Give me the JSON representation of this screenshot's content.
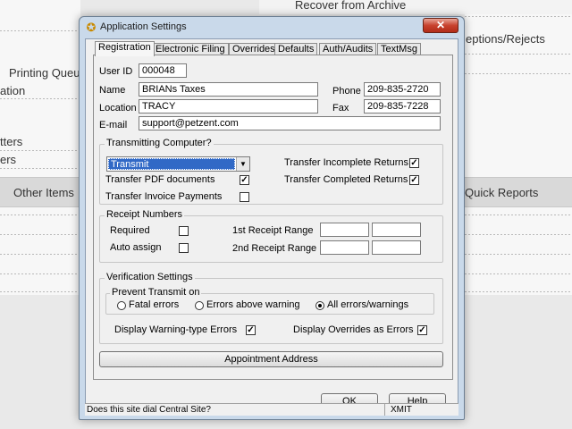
{
  "background": {
    "items": [
      "Recover from Archive",
      "Printing Queue",
      "ation",
      "tters",
      "ers",
      "Other Items",
      "eptions/Rejects",
      "Quick Reports"
    ]
  },
  "dialog": {
    "title": "Application Settings",
    "close_label": "✕",
    "tabs": [
      "Registration",
      "Electronic Filing",
      "Overrides",
      "Defaults",
      "Auth/Audits",
      "TextMsg"
    ],
    "active_tab": "Registration",
    "registration": {
      "user_id_label": "User ID",
      "user_id": "000048",
      "name_label": "Name",
      "name": "BRIANs Taxes",
      "phone_label": "Phone",
      "phone": "209-835-2720",
      "location_label": "Location",
      "location": "TRACY",
      "fax_label": "Fax",
      "fax": "209-835-7228",
      "email_label": "E-mail",
      "email": "support@petzent.com"
    },
    "transmitting": {
      "title": "Transmitting Computer?",
      "combo_value": "Transmit",
      "transfer_pdf": "Transfer PDF documents",
      "transfer_pdf_checked": true,
      "transfer_invoice": "Transfer Invoice Payments",
      "transfer_invoice_checked": false,
      "transfer_incomplete": "Transfer Incomplete Returns",
      "transfer_incomplete_checked": true,
      "transfer_completed": "Transfer Completed Returns",
      "transfer_completed_checked": true
    },
    "receipt": {
      "title": "Receipt Numbers",
      "required": "Required",
      "required_checked": false,
      "auto_assign": "Auto assign",
      "auto_assign_checked": false,
      "first_range": "1st Receipt Range",
      "second_range": "2nd Receipt Range"
    },
    "verification": {
      "title": "Verification Settings",
      "prevent_title": "Prevent Transmit on",
      "options": [
        "Fatal errors",
        "Errors above warning",
        "All errors/warnings"
      ],
      "selected": "All errors/warnings",
      "display_warning": "Display Warning-type Errors",
      "display_warning_checked": true,
      "display_overrides": "Display Overrides as Errors",
      "display_overrides_checked": true
    },
    "appointment_button": "Appointment Address",
    "ok_button": "OK",
    "help_button": "Help",
    "status_text": "Does this site dial Central Site?",
    "status_mode": "XMIT"
  }
}
